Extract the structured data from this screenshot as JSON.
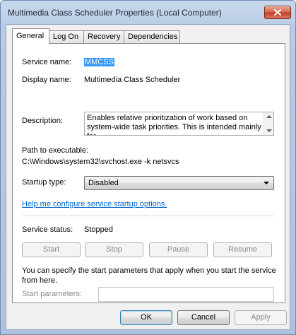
{
  "window": {
    "title": "Multimedia Class Scheduler Properties (Local Computer)"
  },
  "tabs": [
    {
      "label": "General",
      "active": true
    },
    {
      "label": "Log On",
      "active": false
    },
    {
      "label": "Recovery",
      "active": false
    },
    {
      "label": "Dependencies",
      "active": false
    }
  ],
  "general": {
    "service_name_label": "Service name:",
    "service_name_value": "MMCSS",
    "display_name_label": "Display name:",
    "display_name_value": "Multimedia Class Scheduler",
    "description_label": "Description:",
    "description_value": "Enables relative prioritization of work based on system-wide task priorities. This is intended mainly for",
    "path_label": "Path to executable:",
    "path_value": "C:\\Windows\\system32\\svchost.exe -k netsvcs",
    "startup_type_label": "Startup type:",
    "startup_type_value": "Disabled",
    "help_link": "Help me configure service startup options.",
    "service_status_label": "Service status:",
    "service_status_value": "Stopped",
    "buttons": {
      "start": "Start",
      "stop": "Stop",
      "pause": "Pause",
      "resume": "Resume"
    },
    "params_note": "You can specify the start parameters that apply when you start the service from here.",
    "start_params_label": "Start parameters:",
    "start_params_value": ""
  },
  "footer": {
    "ok": "OK",
    "cancel": "Cancel",
    "apply": "Apply"
  },
  "icons": {
    "close": "close-icon",
    "scroll_up": "scroll-up-icon",
    "scroll_down": "scroll-down-icon",
    "dropdown": "chevron-down-icon"
  },
  "colors": {
    "selection": "#3399ff",
    "link": "#0066cc",
    "close_button": "#c1402a"
  }
}
